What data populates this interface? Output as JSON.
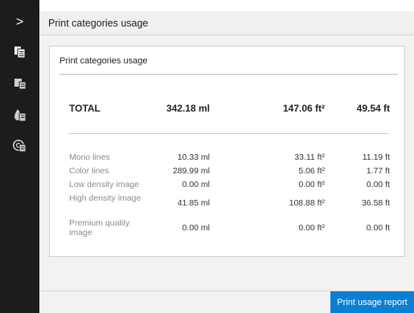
{
  "nav": {
    "toggle_glyph": ">",
    "items": [
      {
        "icon": "pages-icon"
      },
      {
        "icon": "printer-icon"
      },
      {
        "icon": "ink-drop-icon"
      },
      {
        "icon": "disc-icon"
      }
    ]
  },
  "header": {
    "title": "Print categories usage"
  },
  "card": {
    "title": "Print categories usage",
    "total": {
      "label": "TOTAL",
      "ink": "342.18 ml",
      "area": "147.06 ft²",
      "length": "49.54 ft"
    },
    "rows": [
      {
        "label": "Mono lines",
        "ink": "10.33 ml",
        "area": "33.11 ft²",
        "length": "11.19 ft"
      },
      {
        "label": "Color lines",
        "ink": "289.99 ml",
        "area": "5.06 ft²",
        "length": "1.77 ft"
      },
      {
        "label": "Low density image",
        "ink": "0.00 ml",
        "area": "0.00 ft²",
        "length": "0.00 ft"
      },
      {
        "label": "High density image",
        "ink": "41.85 ml",
        "area": "108.88 ft²",
        "length": "36.58 ft"
      },
      {
        "label": "Premium quality image",
        "ink": "0.00 ml",
        "area": "0.00 ft²",
        "length": "0.00 ft"
      }
    ]
  },
  "footer": {
    "report_button": "Print usage report"
  },
  "colors": {
    "sidebar": "#1c1c1c",
    "accent": "#0a7fd4",
    "active_icon": "#ffffff",
    "inactive_icon": "#cfcfcf"
  }
}
